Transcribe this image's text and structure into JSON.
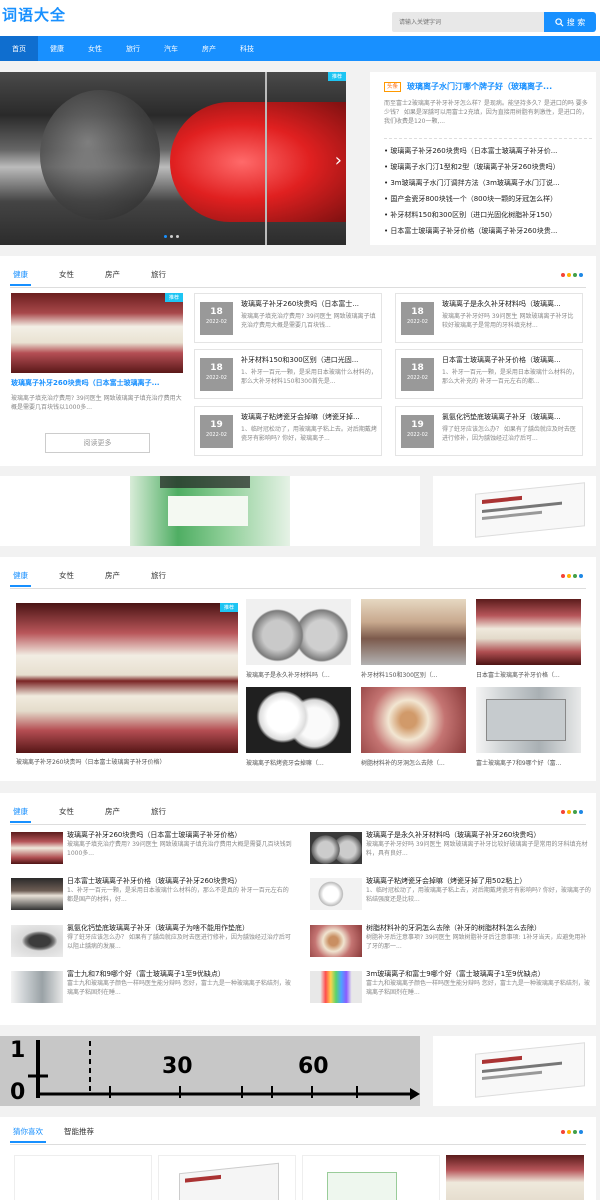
{
  "header": {
    "logo": "词语大全",
    "search_placeholder": "请输入关键字词",
    "search_button": "搜 索"
  },
  "nav": [
    "首页",
    "健康",
    "女性",
    "旅行",
    "汽车",
    "房产",
    "科技"
  ],
  "hero": {
    "badge": "推荐",
    "headline_tag": "头条",
    "headline": "玻璃离子水门汀哪个牌子好（玻璃离子...",
    "summary": "而至富士2玻璃离子补牙补牙怎么样？是现病。能坚持多久？是进口的吗 要多少钱？ 如果是深龋可以用富士2充填，因为直接用树脂有刺激性，是进口的，我们收费是120一颗,...",
    "list": [
      "玻璃离子补牙260块贵吗（日本富士玻璃离子补牙价...",
      "玻璃离子水门汀1型和2型（玻璃离子补牙260块贵吗）",
      "3m玻璃离子水门汀调拌方法（3m玻璃离子水门汀说...",
      "国产金瓷牙800块钱一个（800块一颗的牙冠怎么样）",
      "补牙材料150和300区别（进口光固化树脂补牙150）",
      "日本富士玻璃离子补牙价格（玻璃离子补牙260块贵..."
    ]
  },
  "tabs": [
    "健康",
    "女性",
    "房产",
    "旅行"
  ],
  "sec1": {
    "feature_tag": "推荐",
    "feature_title": "玻璃离子补牙260块贵吗（日本富士玻璃离子...",
    "feature_desc": "玻璃离子填充治疗费用?  39问医生 网致玻璃离子填充治疗费用大概是需要几百块钱以1000多...",
    "more": "阅读更多",
    "cards": [
      {
        "day": "18",
        "ym": "2022-02",
        "title": "玻璃离子补牙260块贵吗（日本富士...",
        "desc": "玻璃离子填充治疗费用?  39问医生 网致玻璃离子填充治疗费用大概是需要几百块钱..."
      },
      {
        "day": "18",
        "ym": "2022-02",
        "title": "玻璃离子是永久补牙材料吗（玻璃离...",
        "desc": "玻璃离子补牙好吗 39问医生 网致玻璃离子补牙比较好玻璃离子是常用的牙科填充材..."
      },
      {
        "day": "18",
        "ym": "2022-02",
        "title": "补牙材料150和300区别（进口光固...",
        "desc": "1、补牙一百元一颗，是采用日本玻璃什么材料的，那么大补牙材料150和300首先是..."
      },
      {
        "day": "18",
        "ym": "2022-02",
        "title": "日本富士玻璃离子补牙价格（玻璃离...",
        "desc": "1、补牙一百元一颗，是采用日本玻璃什么材料的，那么大补充的 补牙一百元左右的都..."
      },
      {
        "day": "19",
        "ym": "2022-02",
        "title": "玻璃离子粘烤瓷牙会掉嘛（烤瓷牙掉...",
        "desc": "1、临时冠松动了，用玻璃离子粘上去。对后期戴烤瓷牙有影响吗? 你好，玻璃离子..."
      },
      {
        "day": "19",
        "ym": "2022-02",
        "title": "氯氨化钙垫底玻璃离子补牙（玻璃离...",
        "desc": "得了蛀牙应该怎么办？ 如果有了龋齿就应及时去医进行修补，因为龋蚀经过治疗后可..."
      }
    ]
  },
  "sec2": {
    "feature_tag": "推荐",
    "feature_caption": "玻璃离子补牙260块贵吗（日本富士玻璃离子补牙价格）",
    "grid": [
      "玻璃离子是永久补牙材料吗（...",
      "补牙材料150和300区别（...",
      "日本富士玻璃离子补牙价格（...",
      "玻璃离子粘烤瓷牙会掉嘛（...",
      "树脂材料补的牙洞怎么去除（...",
      "富士玻璃离子7和9哪个好（富..."
    ]
  },
  "sec3": [
    {
      "title": "玻璃离子补牙260块贵吗（日本富士玻璃离子补牙价格）",
      "desc": "玻璃离子填充治疗费用?  39问医生 网致玻璃离子填充治疗费用大概是需要几百块钱到1000多..."
    },
    {
      "title": "玻璃离子是永久补牙材料吗（玻璃离子补牙260块贵吗）",
      "desc": "玻璃离子补牙好吗  39问医生 网致玻璃离子补牙比较好玻璃离子是常用的牙科填充材料，具有良好..."
    },
    {
      "title": "日本富士玻璃离子补牙价格（玻璃离子补牙260块贵吗）",
      "desc": "1、补牙一百元一颗，是采用日本玻璃什么材料的，那么不是真的 补牙一百元左右的都是国产的材料，好..."
    },
    {
      "title": "玻璃离子粘烤瓷牙会掉嘛（烤瓷牙掉了用502粘上）",
      "desc": "1、临时冠松动了，用玻璃离子粘上去，对后期戴烤瓷牙有影响吗? 你好，玻璃离子的粘结强度还是比较..."
    },
    {
      "title": "氯氨化钙垫底玻璃离子补牙（玻璃离子为啥不能用作垫底）",
      "desc": "得了蛀牙应该怎么办？ 如果有了龋齿就应及时去医进行修补，因为龋蚀经过治疗后可以阻止龋病的发展..."
    },
    {
      "title": "树脂材料补的牙洞怎么去除（补牙的树脂材料怎么去除）",
      "desc": "树脂补牙后注意事项? 39问医生 网致树脂补牙后注意事项: 1补牙当天，应避免用补了牙的那一..."
    },
    {
      "title": "富士九和7和9哪个好（富士玻璃离子1至9优缺点）",
      "desc": "富士九和玻璃离子颜色一样吗医生能分辩吗 您好，富士九是一种玻璃离子粘结剂，玻璃离子粘固剂在睡..."
    },
    {
      "title": "3m玻璃离子和富士9哪个好（富士玻璃离子1至9优缺点）",
      "desc": "富士九和玻璃离子颜色一样吗医生能分辩吗 您好，富士九是一种玻璃离子粘结剂，玻璃离子粘固剂在睡..."
    }
  ],
  "ruler": [
    "1",
    "0",
    "30",
    "60"
  ],
  "bottom_tabs": [
    "猜你喜欢",
    "智能推荐"
  ],
  "colors": {
    "accent": "#1890ff",
    "dot1": "#f44336",
    "dot2": "#ffb300",
    "dot3": "#43a047",
    "dot4": "#1e88e5"
  }
}
